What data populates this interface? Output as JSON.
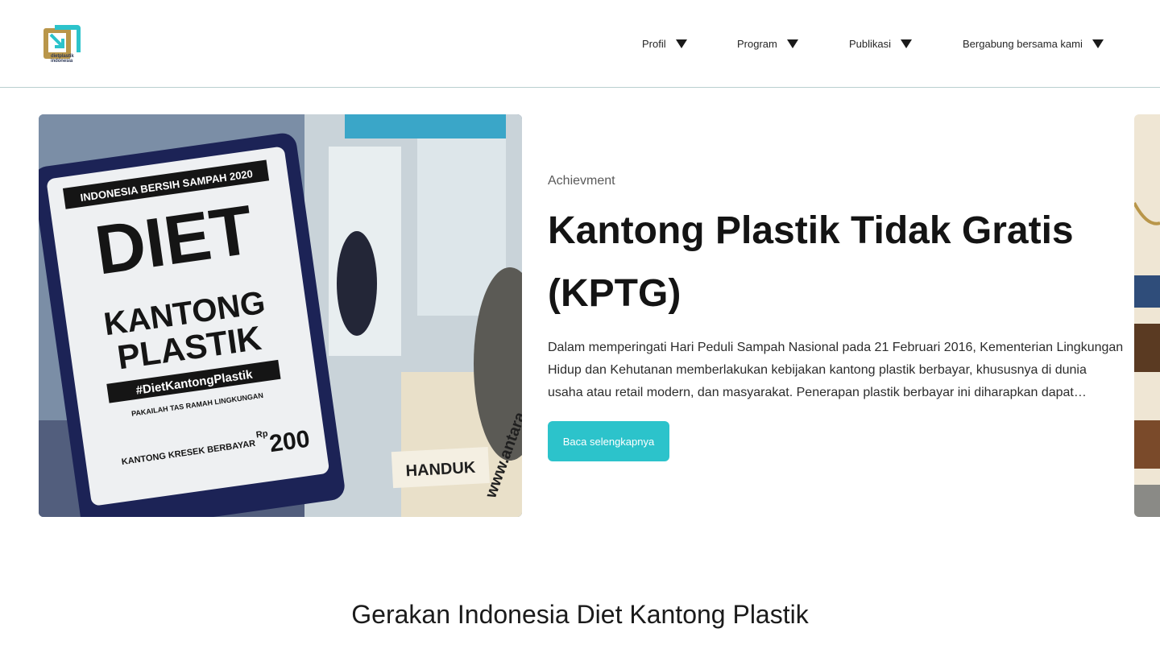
{
  "brand": {
    "logo_text": "dietplastik\nindonesia",
    "colors": {
      "gold": "#b9964a",
      "teal": "#2cc3cb",
      "navy": "#2f3b5a"
    }
  },
  "nav": {
    "items": [
      {
        "label": "Profil"
      },
      {
        "label": "Program"
      },
      {
        "label": "Publikasi"
      },
      {
        "label": "Bergabung bersama kami"
      }
    ]
  },
  "hero": {
    "image_icon": "hero-photo-icon",
    "sign": {
      "banner": "INDONESIA BERSIH SAMPAH 2020",
      "line1": "DIET",
      "line2": "KANTONG",
      "line3": "PLASTIK",
      "hashtag": "#DietKantongPlastik",
      "tagline": "PAKAILAH TAS RAMAH LINGKUNGAN",
      "price_label": "KANTONG KRESEK\nBERBAYAR",
      "price_prefix": "Rp",
      "price_value": "200",
      "shop_sign": "HANDUK",
      "watermark": "www.antara"
    },
    "category": "Achievment",
    "title": "Kantong Plastik Tidak Gratis (KPTG)",
    "description": "Dalam memperingati Hari Peduli Sampah Nasional pada 21 Februari 2016, Kementerian Lingkungan Hidup dan Kehutanan memberlakukan kebijakan kantong plastik berbayar, khususnya di dunia usaha atau retail modern, dan masyarakat. Penerapan plastik berbayar ini diharapkan dapat mengurangi sampah plastik.",
    "button_label": "Baca selengkapnya"
  },
  "section": {
    "title": "Gerakan Indonesia Diet Kantong Plastik"
  }
}
